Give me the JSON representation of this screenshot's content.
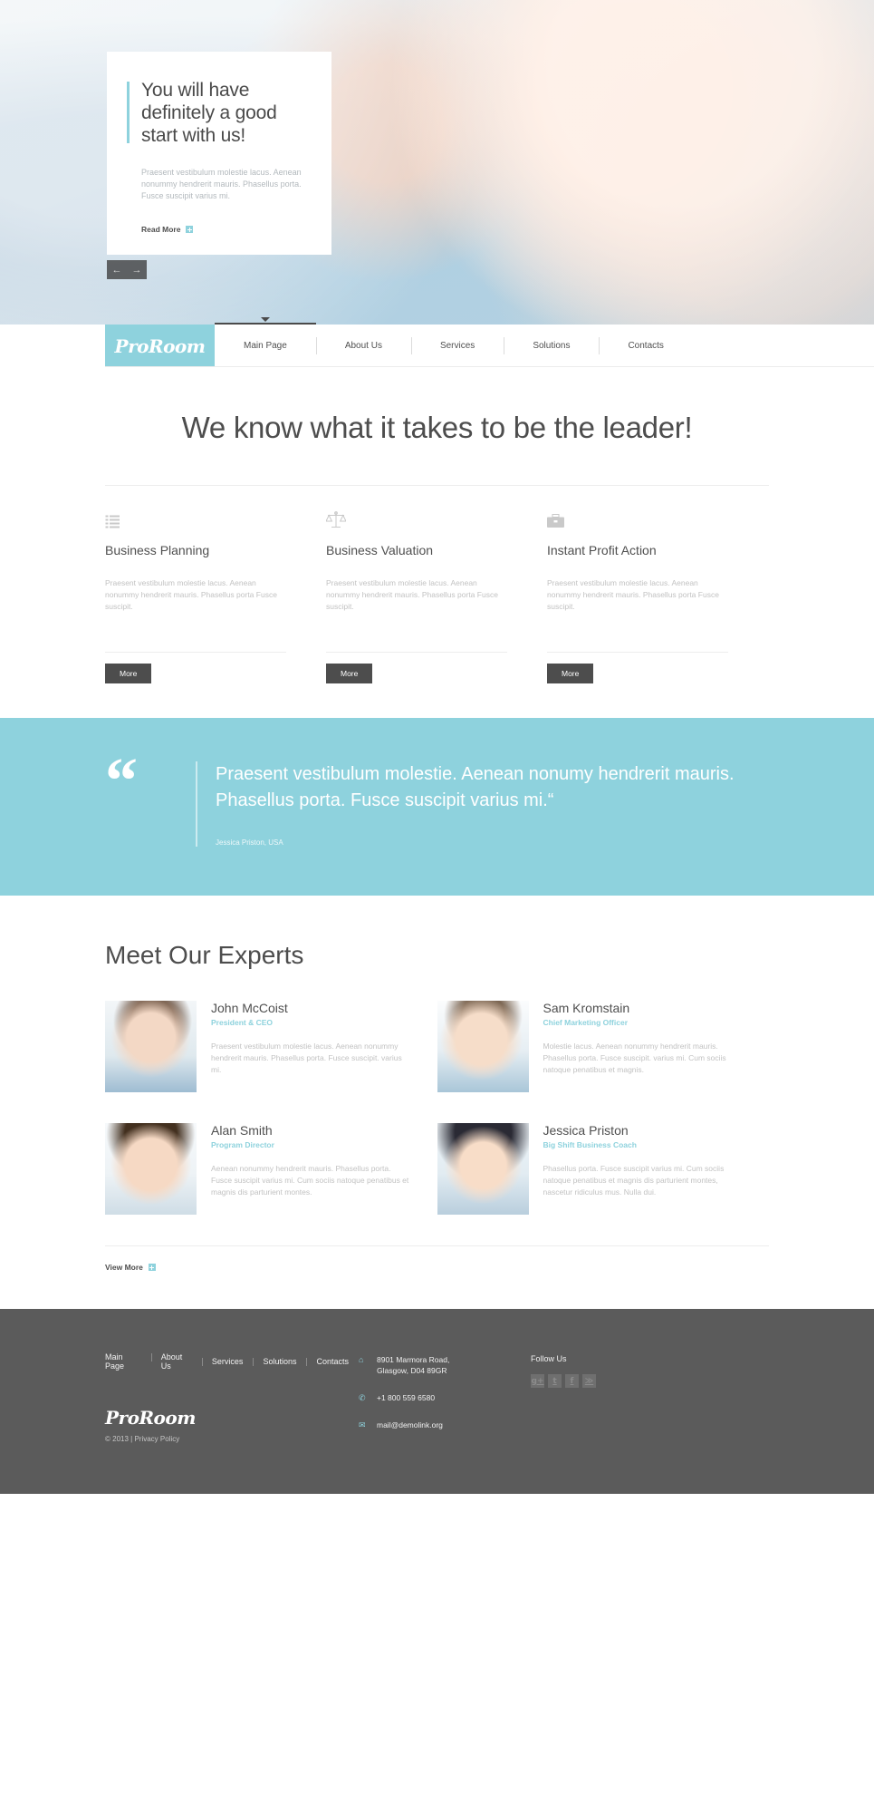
{
  "brand": {
    "name": "ProRoom",
    "accent": "#8ed2dd",
    "dark": "#4d4d4d",
    "footer_bg": "#5b5b5b"
  },
  "hero": {
    "title": "You will have definitely a good start with us!",
    "text": "Praesent vestibulum molestie lacus. Aenean nonummy hendrerit mauris. Phasellus porta. Fusce suscipit varius mi.",
    "read_more": "Read More",
    "prev_arrow": "←",
    "next_arrow": "→"
  },
  "nav": {
    "logo": "ProRoom",
    "items": [
      {
        "label": "Main Page",
        "active": true
      },
      {
        "label": "About Us",
        "active": false
      },
      {
        "label": "Services",
        "active": false
      },
      {
        "label": "Solutions",
        "active": false
      },
      {
        "label": "Contacts",
        "active": false
      }
    ]
  },
  "intro": {
    "heading": "We know what it takes to be the leader!"
  },
  "services": [
    {
      "icon": "list-icon",
      "title": "Business Planning",
      "text": "Praesent vestibulum molestie lacus. Aenean nonummy hendrerit mauris. Phasellus porta Fusce suscipit.",
      "button": "More"
    },
    {
      "icon": "scales-icon",
      "title": "Business Valuation",
      "text": "Praesent vestibulum molestie lacus. Aenean nonummy hendrerit mauris. Phasellus porta Fusce suscipit.",
      "button": "More"
    },
    {
      "icon": "briefcase-icon",
      "title": "Instant Profit Action",
      "text": "Praesent vestibulum molestie lacus. Aenean nonummy hendrerit mauris. Phasellus porta Fusce suscipit.",
      "button": "More"
    }
  ],
  "testimonial": {
    "quote_mark": "“",
    "text": "Praesent vestibulum molestie. Aenean nonumy hendrerit mauris. Phasellus porta. Fusce suscipit varius mi.“",
    "author": "Jessica Priston, USA"
  },
  "experts": {
    "heading": "Meet Our Experts",
    "people": [
      {
        "name": "John McCoist",
        "role": "President & CEO",
        "bio": "Praesent vestibulum molestie lacus. Aenean nonummy hendrerit mauris. Phasellus porta. Fusce suscipit. varius mi.",
        "photo": "portrait-man-glasses"
      },
      {
        "name": "Sam Kromstain",
        "role": "Chief Marketing Officer",
        "bio": "Molestie lacus. Aenean nonummy hendrerit mauris. Phasellus porta. Fusce suscipit. varius mi. Cum sociis natoque penatibus et magnis.",
        "photo": "portrait-man-smiling"
      },
      {
        "name": "Alan Smith",
        "role": "Program Director",
        "bio": "Aenean nonummy hendrerit mauris. Phasellus porta. Fusce suscipit varius mi. Cum sociis natoque penatibus et magnis dis parturient montes.",
        "photo": "portrait-woman-light"
      },
      {
        "name": "Jessica Priston",
        "role": "Big Shift Business Coach",
        "bio": "Phasellus porta. Fusce suscipit varius mi. Cum sociis natoque penatibus et magnis dis parturient montes, nascetur ridiculus mus. Nulla dui.",
        "photo": "portrait-woman-dark"
      }
    ],
    "view_more": "View More"
  },
  "footer": {
    "nav": [
      "Main Page",
      "About Us",
      "Services",
      "Solutions",
      "Contacts"
    ],
    "logo": "ProRoom",
    "copyright": "© 2013  |  Privacy Policy",
    "contacts": [
      {
        "icon": "home-icon",
        "glyph": "⌂",
        "line1": "8901 Marmora Road,",
        "line2": "Glasgow, D04 89GR"
      },
      {
        "icon": "phone-icon",
        "glyph": "✆",
        "line1": "+1 800 559 6580",
        "line2": ""
      },
      {
        "icon": "mail-icon",
        "glyph": "✉",
        "line1": "mail@demolink.org",
        "line2": ""
      }
    ],
    "follow_label": "Follow Us",
    "socials": [
      {
        "name": "google-plus-icon",
        "glyph": "g+"
      },
      {
        "name": "twitter-icon",
        "glyph": "t"
      },
      {
        "name": "facebook-icon",
        "glyph": "f"
      },
      {
        "name": "rss-icon",
        "glyph": "≫"
      }
    ]
  }
}
